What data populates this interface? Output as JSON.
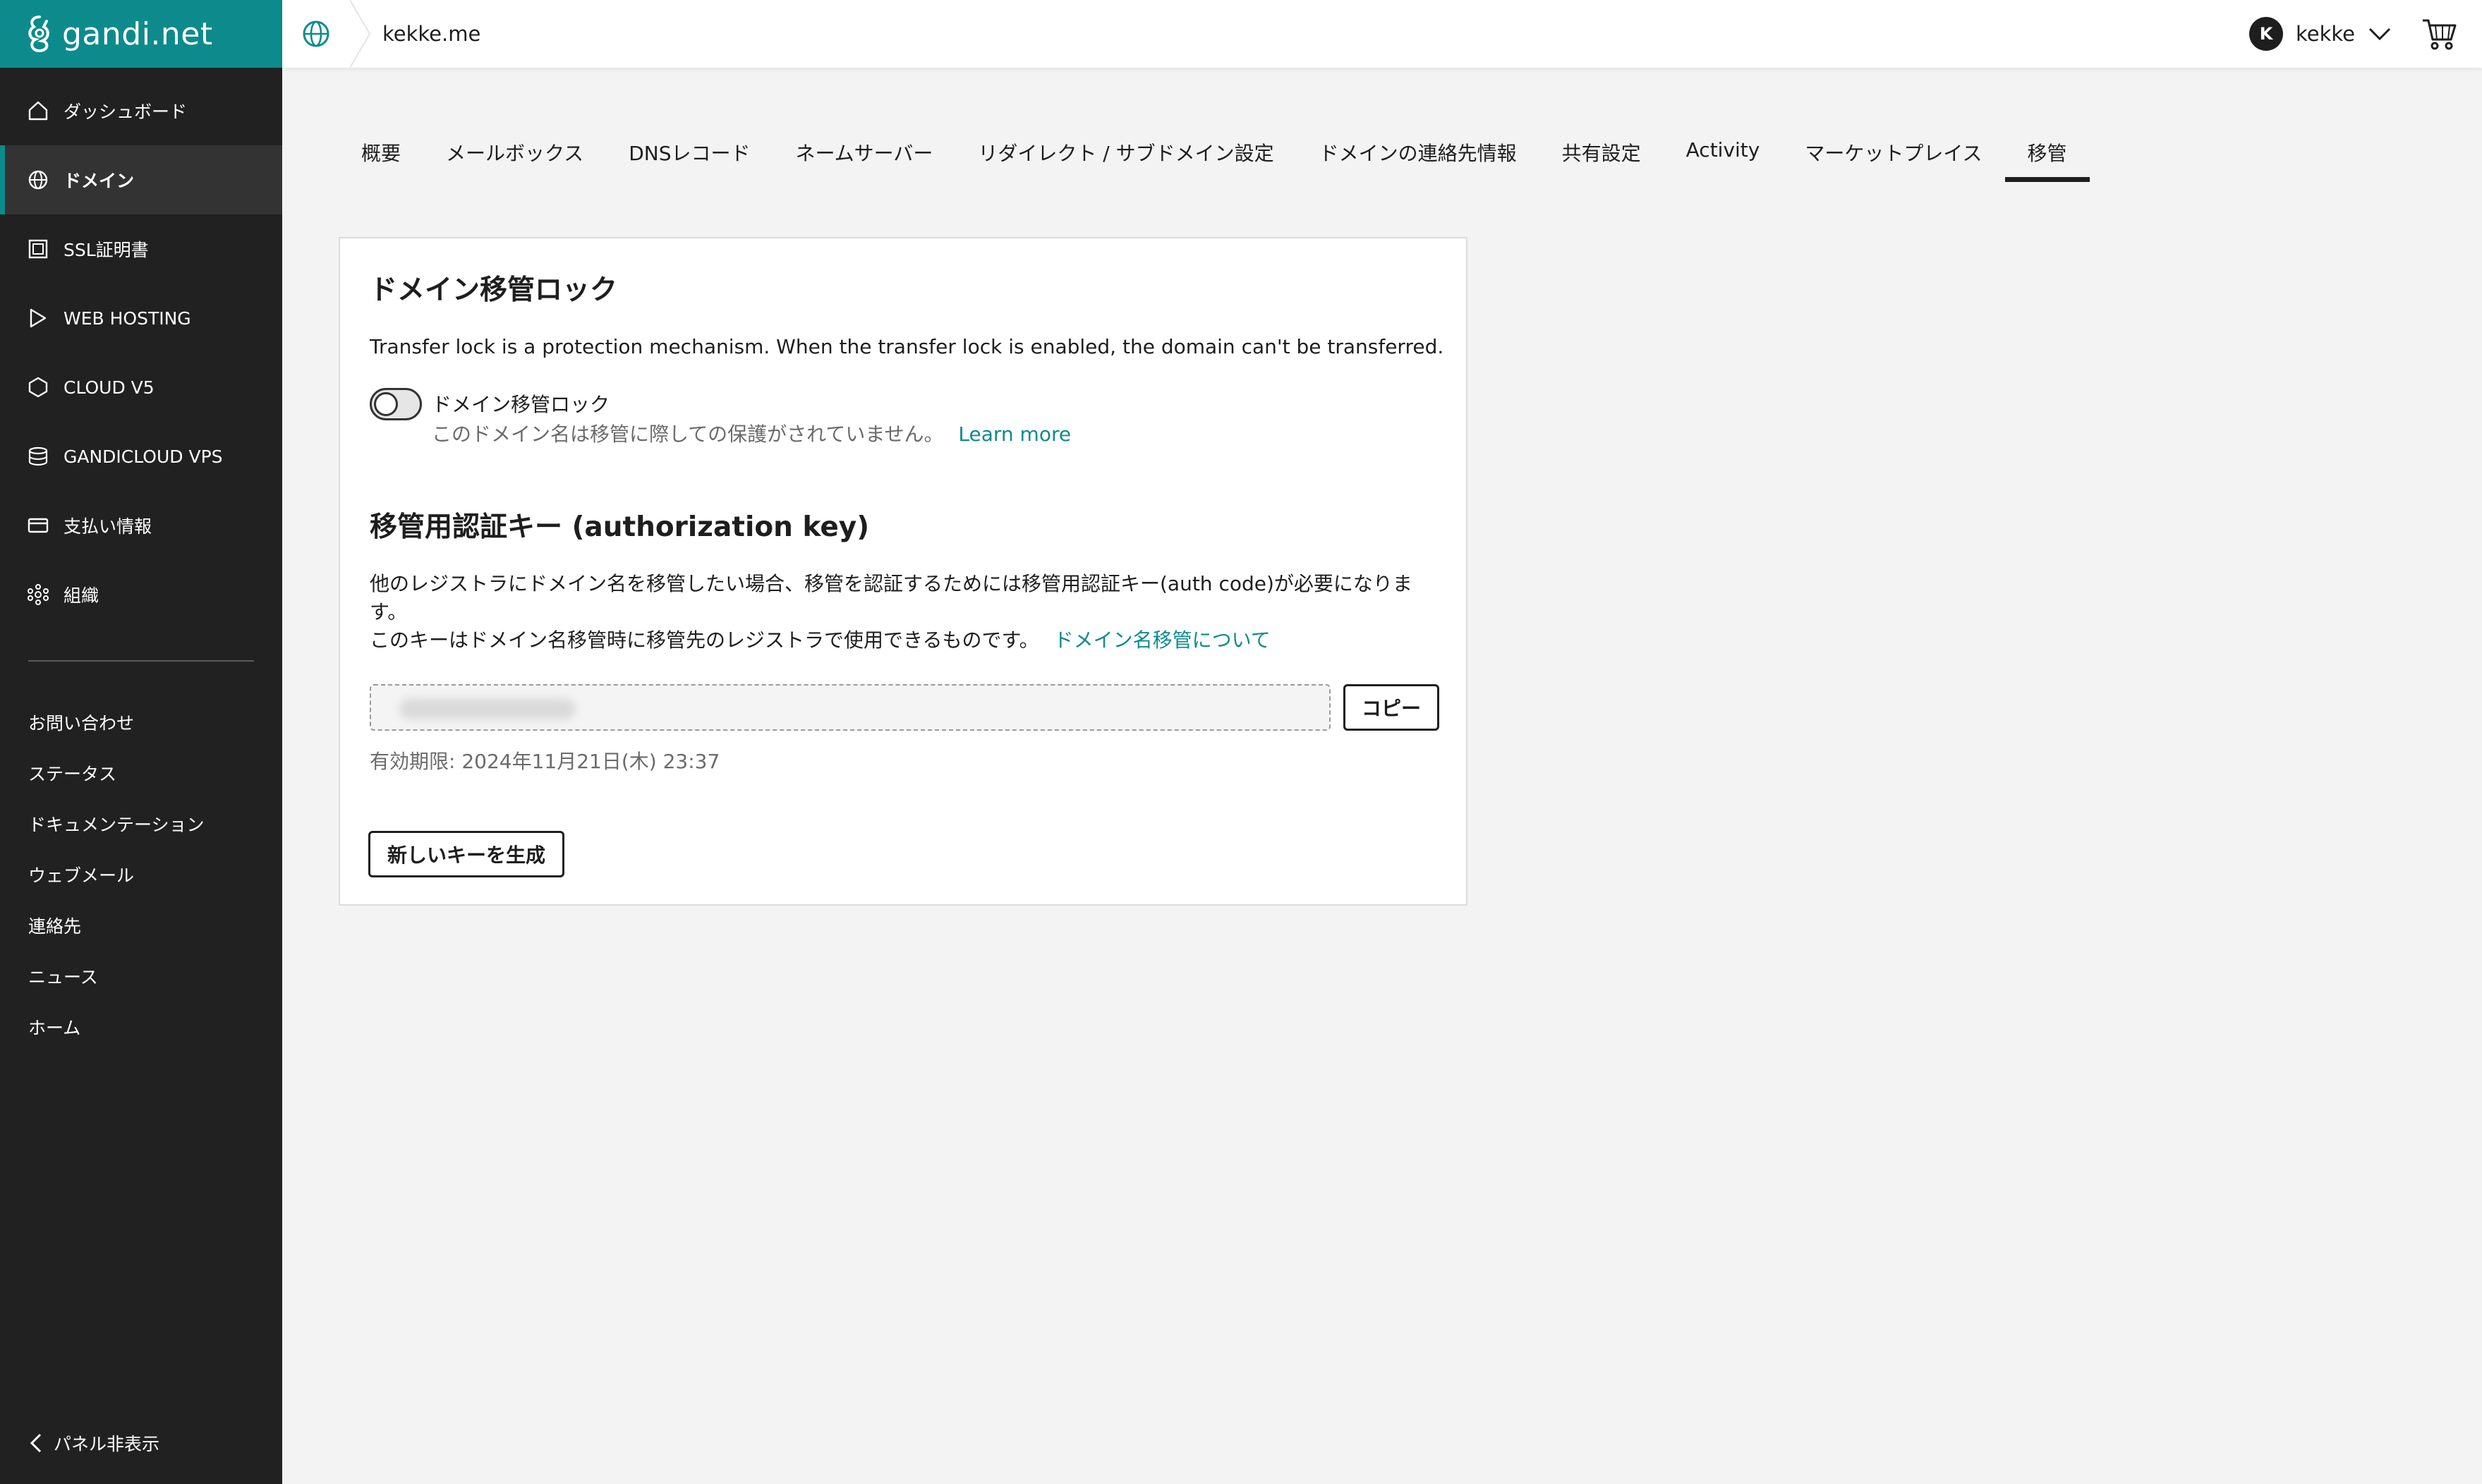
{
  "brand": {
    "name": "gandi.net",
    "accent": "#0d8b8c"
  },
  "sidebar": {
    "items": [
      {
        "label": "ダッシュボード",
        "icon": "home-icon"
      },
      {
        "label": "ドメイン",
        "icon": "globe-icon",
        "active": true
      },
      {
        "label": "SSL証明書",
        "icon": "certificate-icon"
      },
      {
        "label": "WEB HOSTING",
        "icon": "hosting-icon"
      },
      {
        "label": "CLOUD V5",
        "icon": "cloud-icon"
      },
      {
        "label": "GANDICLOUD VPS",
        "icon": "server-icon"
      },
      {
        "label": "支払い情報",
        "icon": "card-icon"
      },
      {
        "label": "組織",
        "icon": "organization-icon"
      }
    ],
    "links": [
      "お問い合わせ",
      "ステータス",
      "ドキュメンテーション",
      "ウェブメール",
      "連絡先",
      "ニュース",
      "ホーム"
    ],
    "hide_panel": "パネル非表示"
  },
  "header": {
    "domain": "kekke.me",
    "user": "kekke",
    "avatar_initial": "K"
  },
  "tabs": [
    "概要",
    "メールボックス",
    "DNSレコード",
    "ネームサーバー",
    "リダイレクト / サブドメイン設定",
    "ドメインの連絡先情報",
    "共有設定",
    "Activity",
    "マーケットプレイス",
    "移管"
  ],
  "active_tab": "移管",
  "transfer_lock": {
    "title": "ドメイン移管ロック",
    "description": "Transfer lock is a protection mechanism. When the transfer lock is enabled, the domain can't be transferred.",
    "toggle_label": "ドメイン移管ロック",
    "toggle_on": false,
    "status": "このドメイン名は移管に際しての保護がされていません。",
    "learn_more": "Learn more"
  },
  "auth_key": {
    "title": "移管用認証キー (authorization key)",
    "desc_line1": "他のレジストラにドメイン名を移管したい場合、移管を認証するためには移管用認証キー(auth code)が必要になりま",
    "desc_line1b": "す。",
    "desc_line2": "このキーはドメイン名移管時に移管先のレジストラで使用できるものです。",
    "desc_link": "ドメイン名移管について",
    "copy_label": "コピー",
    "expiry": "有効期限: 2024年11月21日(木) 23:37",
    "generate_label": "新しいキーを生成"
  }
}
